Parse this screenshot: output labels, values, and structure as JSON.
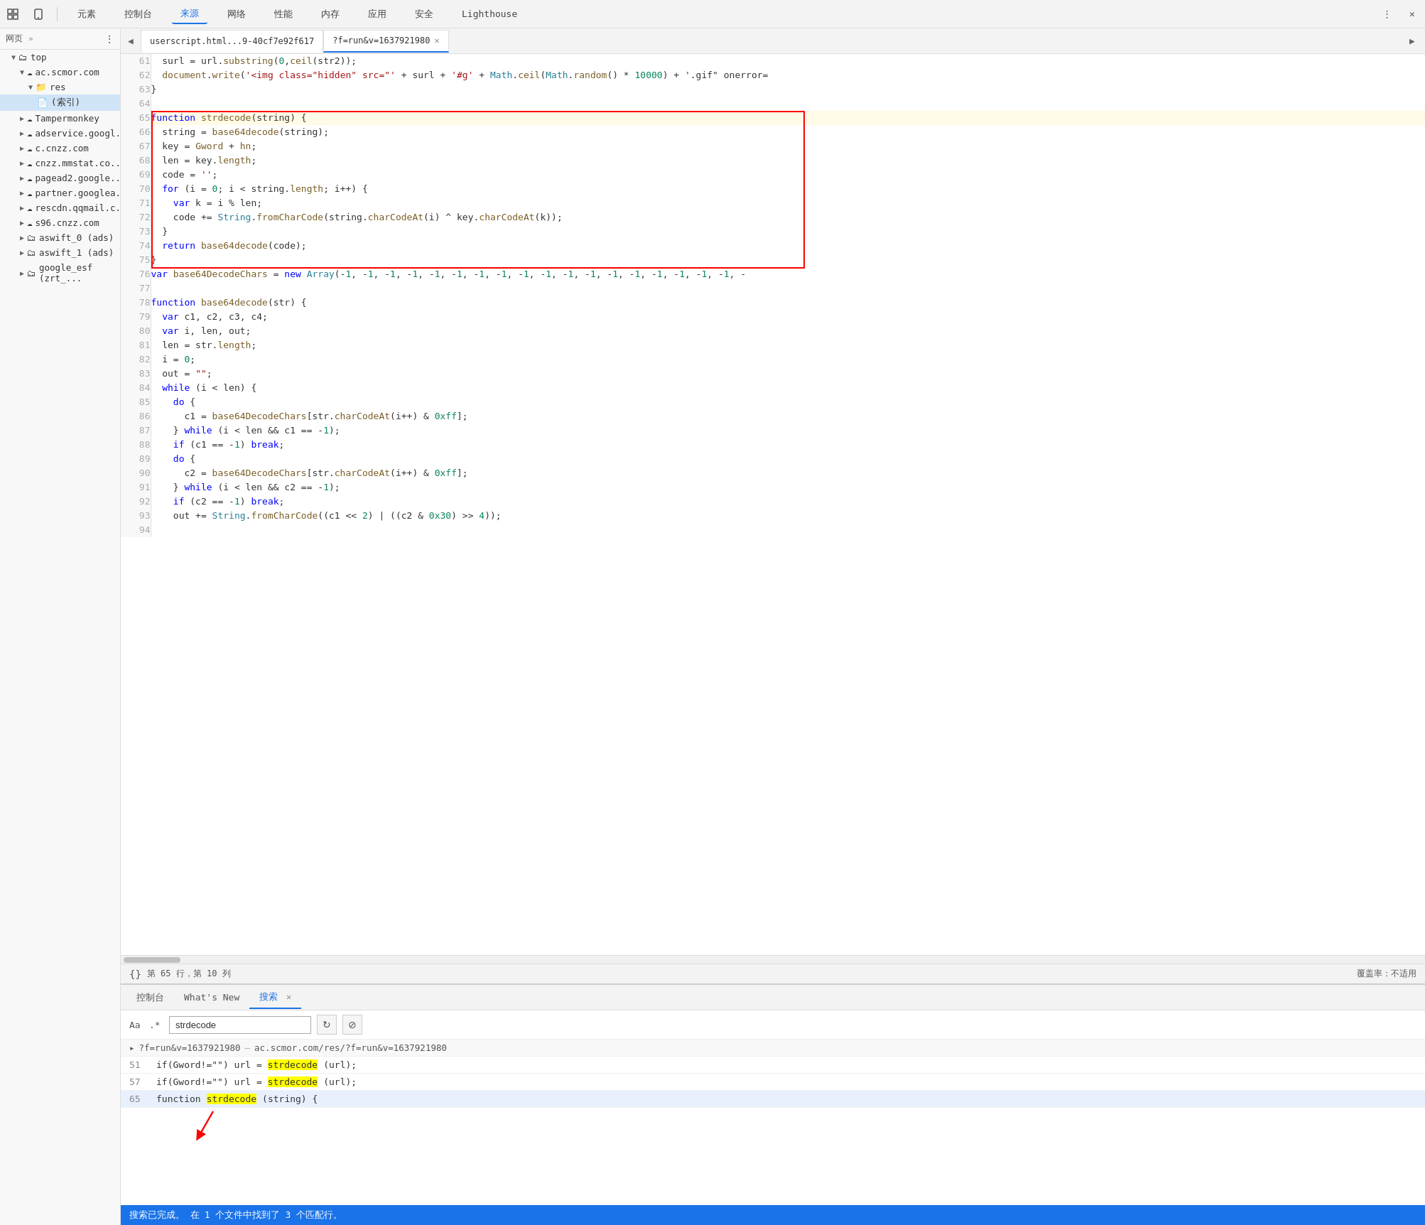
{
  "toolbar": {
    "tabs": [
      {
        "label": "元素",
        "active": false
      },
      {
        "label": "控制台",
        "active": false
      },
      {
        "label": "来源",
        "active": true
      },
      {
        "label": "网络",
        "active": false
      },
      {
        "label": "性能",
        "active": false
      },
      {
        "label": "内存",
        "active": false
      },
      {
        "label": "应用",
        "active": false
      },
      {
        "label": "安全",
        "active": false
      },
      {
        "label": "Lighthouse",
        "active": false
      }
    ]
  },
  "sidebar": {
    "page_label": "网页",
    "items": [
      {
        "label": "top",
        "indent": 0,
        "type": "folder",
        "open": true
      },
      {
        "label": "ac.scmor.com",
        "indent": 1,
        "type": "folder",
        "open": true
      },
      {
        "label": "res",
        "indent": 2,
        "type": "folder",
        "open": true
      },
      {
        "label": "(索引)",
        "indent": 3,
        "type": "file",
        "selected": true
      },
      {
        "label": "Tampermonkey",
        "indent": 1,
        "type": "folder",
        "open": false
      },
      {
        "label": "adservice.googl...",
        "indent": 1,
        "type": "folder",
        "open": false
      },
      {
        "label": "c.cnzz.com",
        "indent": 1,
        "type": "folder",
        "open": false
      },
      {
        "label": "cnzz.mmstat.co...",
        "indent": 1,
        "type": "folder",
        "open": false
      },
      {
        "label": "pagead2.google...",
        "indent": 1,
        "type": "folder",
        "open": false
      },
      {
        "label": "partner.googlea...",
        "indent": 1,
        "type": "folder",
        "open": false
      },
      {
        "label": "rescdn.qqmail.c...",
        "indent": 1,
        "type": "folder",
        "open": false
      },
      {
        "label": "s96.cnzz.com",
        "indent": 1,
        "type": "folder",
        "open": false
      },
      {
        "label": "aswift_0 (ads)",
        "indent": 1,
        "type": "folder",
        "open": false
      },
      {
        "label": "aswift_1 (ads)",
        "indent": 1,
        "type": "folder",
        "open": false
      },
      {
        "label": "google_esf (zrt_...",
        "indent": 1,
        "type": "folder",
        "open": false
      }
    ]
  },
  "editor": {
    "tab1_label": "userscript.html...9-40cf7e92f617",
    "tab2_label": "?f=run&v=1637921980",
    "status_line": "第 65 行，第 10 列",
    "coverage": "覆盖率：不适用",
    "lines": [
      {
        "num": 61,
        "code": "  surl = url.substring(0,ceil(str2));"
      },
      {
        "num": 62,
        "code": "  document.write('<img class=\"hidden\" src=\"' + surl + '#g' + Math.ceil(Math.random() * 10000) + '.gif\" onerror="
      },
      {
        "num": 63,
        "code": "}"
      },
      {
        "num": 64,
        "code": ""
      },
      {
        "num": 65,
        "code": "function strdecode(string) {",
        "highlight_start": true
      },
      {
        "num": 66,
        "code": "  string = base64decode(string);"
      },
      {
        "num": 67,
        "code": "  key = Gword + hn;"
      },
      {
        "num": 68,
        "code": "  len = key.length;"
      },
      {
        "num": 69,
        "code": "  code = '';"
      },
      {
        "num": 70,
        "code": "  for (i = 0; i < string.length; i++) {"
      },
      {
        "num": 71,
        "code": "    var k = i % len;"
      },
      {
        "num": 72,
        "code": "    code += String.fromCharCode(string.charCodeAt(i) ^ key.charCodeAt(k));"
      },
      {
        "num": 73,
        "code": "  }"
      },
      {
        "num": 74,
        "code": "  return base64decode(code);"
      },
      {
        "num": 75,
        "code": "}",
        "highlight_end": true
      },
      {
        "num": 76,
        "code": "var base64DecodeChars = new Array(-1, -1, -1, -1, -1, -1, -1, -1, -1, -1, -1, -1, -1, -1, -1, -1, -1, -1, -"
      },
      {
        "num": 77,
        "code": ""
      },
      {
        "num": 78,
        "code": "function base64decode(str) {"
      },
      {
        "num": 79,
        "code": "  var c1, c2, c3, c4;"
      },
      {
        "num": 80,
        "code": "  var i, len, out;"
      },
      {
        "num": 81,
        "code": "  len = str.length;"
      },
      {
        "num": 82,
        "code": "  i = 0;"
      },
      {
        "num": 83,
        "code": "  out = \"\";"
      },
      {
        "num": 84,
        "code": "  while (i < len) {"
      },
      {
        "num": 85,
        "code": "    do {"
      },
      {
        "num": 86,
        "code": "      c1 = base64DecodeChars[str.charCodeAt(i++) & 0xff];"
      },
      {
        "num": 87,
        "code": "    } while (i < len && c1 == -1);"
      },
      {
        "num": 88,
        "code": "    if (c1 == -1) break;"
      },
      {
        "num": 89,
        "code": "    do {"
      },
      {
        "num": 90,
        "code": "      c2 = base64DecodeChars[str.charCodeAt(i++) & 0xff];"
      },
      {
        "num": 91,
        "code": "    } while (i < len && c2 == -1);"
      },
      {
        "num": 92,
        "code": "    if (c2 == -1) break;"
      },
      {
        "num": 93,
        "code": "    out += String.fromCharCode((c1 << 2) | ((c2 & 0x30) >> 4));"
      },
      {
        "num": 94,
        "code": ""
      }
    ]
  },
  "bottom_panel": {
    "tabs": [
      {
        "label": "控制台",
        "active": false
      },
      {
        "label": "What's New",
        "active": false
      },
      {
        "label": "搜索",
        "active": true,
        "closeable": true
      }
    ],
    "search": {
      "options_label": "Aa",
      "regex_label": ".*",
      "input_value": "strdecode",
      "input_placeholder": "strdecode"
    },
    "file_result": {
      "arrow_label": "▸",
      "url_short": "?f=run&v=1637921980",
      "url_full": "ac.scmor.com/res/?f=run&v=1637921980",
      "matches": [
        {
          "line": 51,
          "code_before": "  if(Gword!=\"\") url = ",
          "match": "strdecode",
          "code_after": "(url);"
        },
        {
          "line": 57,
          "code_before": "  if(Gword!=\"\") url = ",
          "match": "strdecode",
          "code_after": "(url);"
        },
        {
          "line": 65,
          "code_before": "function ",
          "match": "strdecode",
          "code_after": "(string) {",
          "selected": true
        }
      ]
    },
    "status": "搜索已完成。 在 1 个文件中找到了 3 个匹配行。"
  }
}
